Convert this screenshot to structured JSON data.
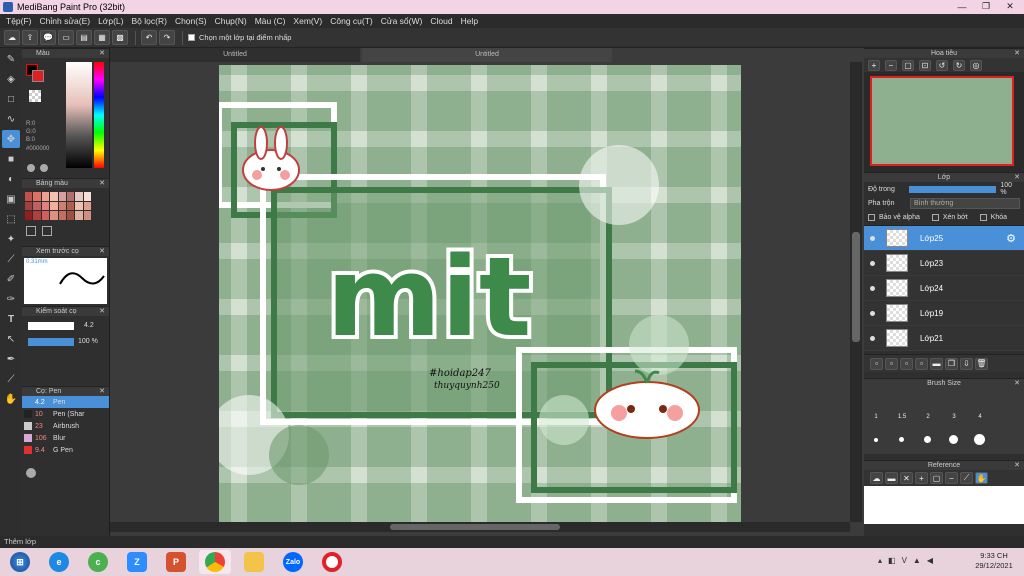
{
  "window": {
    "title": "MediBang Paint Pro (32bit)",
    "minimize": "—",
    "maximize": "❐",
    "close": "✕"
  },
  "menu": [
    "Tệp(F)",
    "Chỉnh sửa(E)",
    "Lớp(L)",
    "Bộ lọc(R)",
    "Chọn(S)",
    "Chụp(N)",
    "Màu (C)",
    "Xem(V)",
    "Công cụ(T)",
    "Cửa sổ(W)",
    "Cloud",
    "Help"
  ],
  "toolbar": {
    "checkbox_label": "Chọn một lớp tại điểm nhấp"
  },
  "tabs": {
    "tab1": "Untitled",
    "tab2": "Untitled"
  },
  "left": {
    "color_panel_title": "Màu",
    "rgb": {
      "r": "R:0",
      "g": "G:0",
      "b": "B:0"
    },
    "hex": "#000000",
    "palette_title": "Bảng màu",
    "brush_preview_title": "Xem trước cọ",
    "brush_size_text": "0.31mm",
    "brush_control_title": "Kiểm soát cọ",
    "brush_size_value": "4.2",
    "opacity_value": "100 %",
    "brush_list_title": "Cọ: Pen",
    "brushes": [
      {
        "size": "4.2",
        "name": "Pen",
        "color": "#4a90d9"
      },
      {
        "size": "10",
        "name": "Pen (Shar",
        "color": "#222222"
      },
      {
        "size": "23",
        "name": "Airbrush",
        "color": "#cccccc"
      },
      {
        "size": "106",
        "name": "Blur",
        "color": "#d9a8d9"
      },
      {
        "size": "9.4",
        "name": "G Pen",
        "color": "#e03030"
      }
    ]
  },
  "canvas": {
    "title_text": "mit",
    "signature_line1": "#hoidap247",
    "signature_line2": "thuyquynh250"
  },
  "right": {
    "navigator_title": "Hoa tiêu",
    "layer_title": "Lớp",
    "opacity_label": "Độ trong",
    "opacity_value": "100 %",
    "blend_label": "Pha trộn",
    "blend_value": "Bình thường",
    "protect_alpha": "Bảo vệ alpha",
    "clipping": "Xén bớt",
    "lock": "Khóa",
    "layers": [
      {
        "name": "Lớp25",
        "selected": true
      },
      {
        "name": "Lớp23",
        "selected": false
      },
      {
        "name": "Lớp24",
        "selected": false
      },
      {
        "name": "Lớp19",
        "selected": false
      },
      {
        "name": "Lớp21",
        "selected": false
      }
    ],
    "brush_size_title": "Brush Size",
    "brush_size_labels": [
      "1",
      "1.5",
      "2",
      "3",
      "4"
    ],
    "reference_title": "Reference"
  },
  "status": {
    "text": "Thêm lớp"
  },
  "taskbar": {
    "time": "9:33 CH",
    "date": "29/12/2021",
    "apps": [
      "windows-start",
      "internet-explorer",
      "coc-coc",
      "zoom",
      "powerpoint",
      "chrome",
      "file-explorer",
      "zalo",
      "opera"
    ],
    "zalo_label": "Zalo",
    "ppt_label": "P",
    "zoom_label": "Z"
  },
  "colors": {
    "canvas_bg": "#8fb08f",
    "accent": "#4a90d9",
    "plaid": "#c7d8c7"
  }
}
